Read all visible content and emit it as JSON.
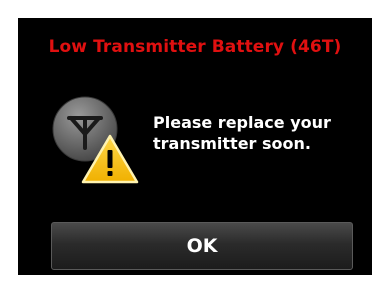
{
  "alert": {
    "title": "Low Transmitter Battery (46T)",
    "message_line1": "Please replace your",
    "message_line2": "transmitter soon.",
    "icon": "transmitter-warning-icon",
    "ok_label": "OK"
  },
  "colors": {
    "background": "#000000",
    "title_red": "#e01010",
    "warning_yellow": "#f6c21c",
    "text": "#ffffff"
  }
}
